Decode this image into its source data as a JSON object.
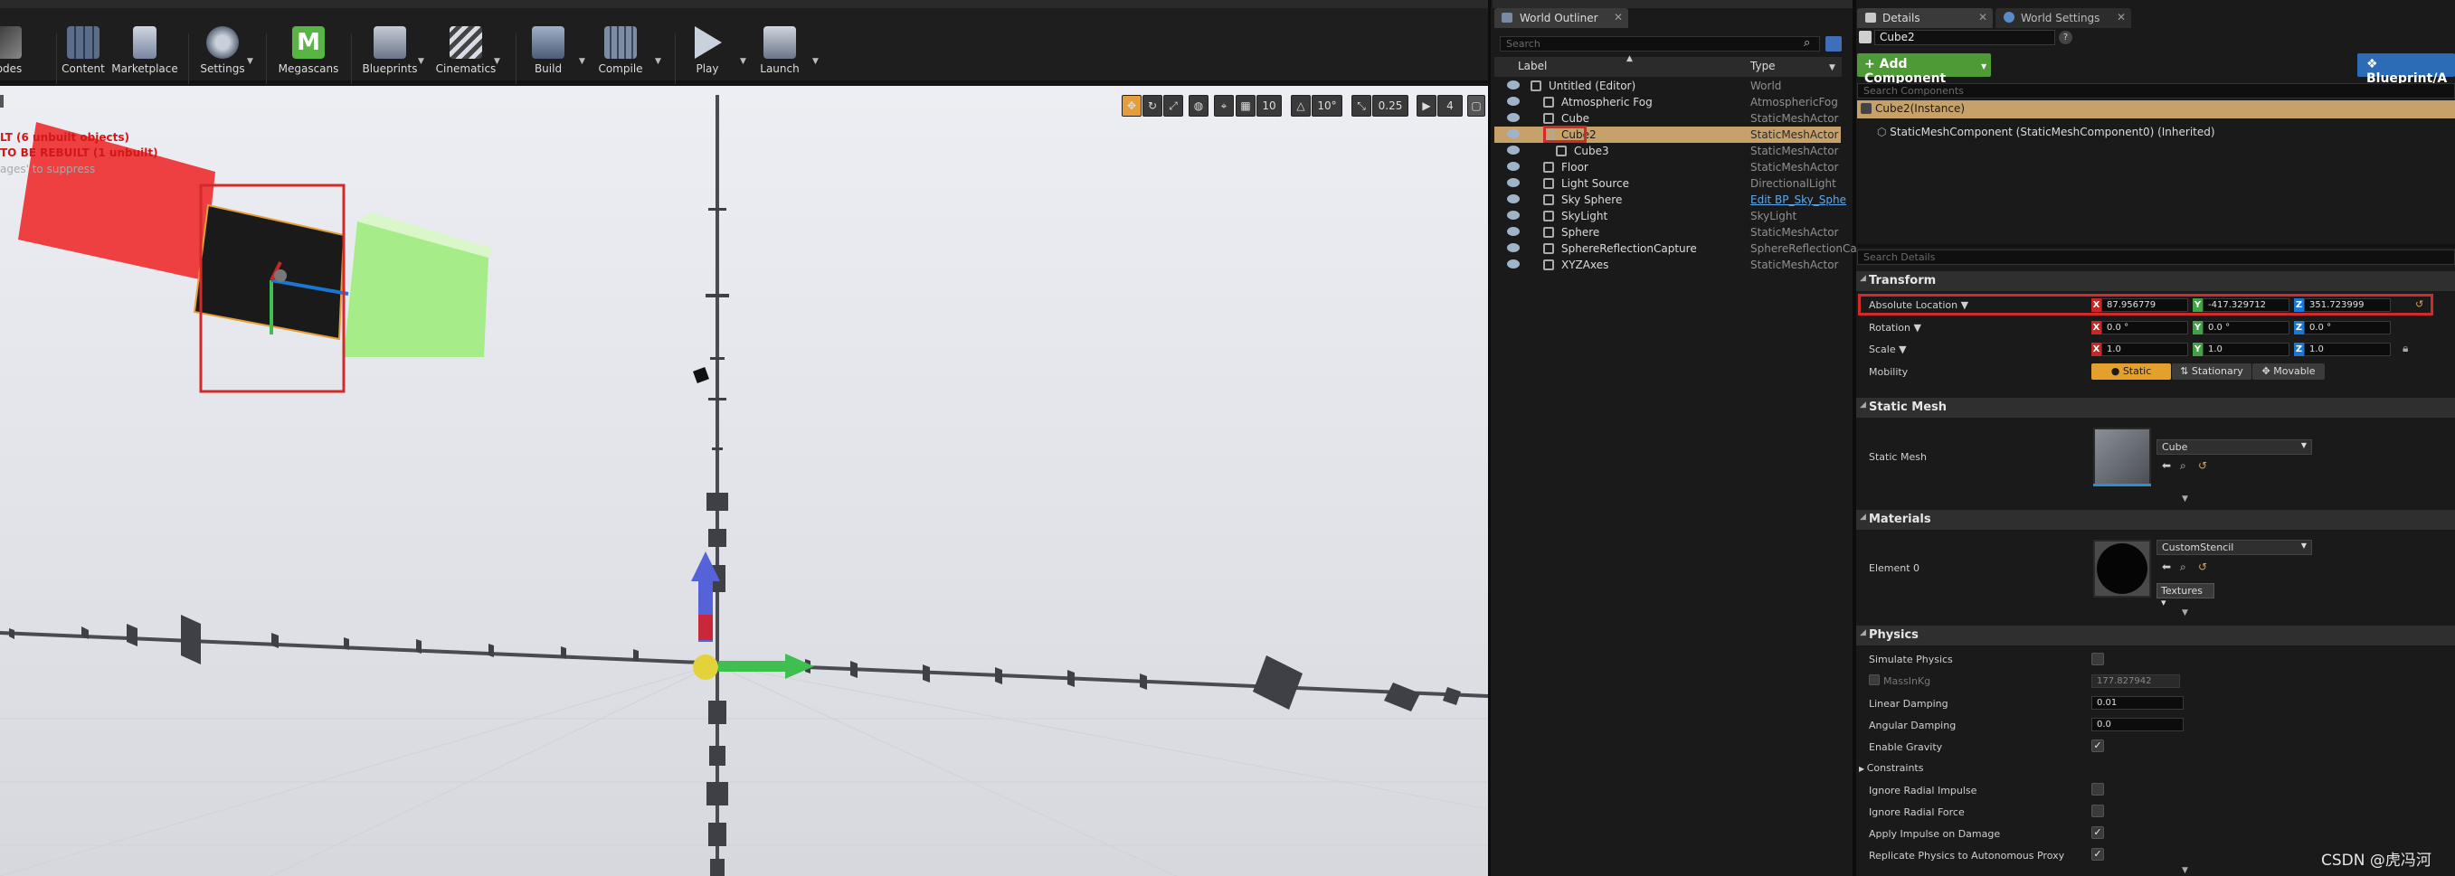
{
  "toolbar": {
    "buttons": [
      {
        "label": "odes",
        "icon": "modes-icon"
      },
      {
        "label": "Content",
        "icon": "content-icon"
      },
      {
        "label": "Marketplace",
        "icon": "marketplace-icon"
      },
      {
        "label": "Settings",
        "icon": "settings-icon"
      },
      {
        "label": "Megascans",
        "icon": "megascans-icon"
      },
      {
        "label": "Blueprints",
        "icon": "blueprints-icon"
      },
      {
        "label": "Cinematics",
        "icon": "cinematics-icon"
      },
      {
        "label": "Build",
        "icon": "build-icon"
      },
      {
        "label": "Compile",
        "icon": "compile-icon"
      },
      {
        "label": "Play",
        "icon": "play-icon"
      },
      {
        "label": "Launch",
        "icon": "launch-icon"
      }
    ]
  },
  "viewport": {
    "messages": [
      "LT (6 unbuilt objects)",
      "TO BE REBUILT (1 unbuilt)",
      "ages' to suppress"
    ],
    "snap": {
      "grid": "10",
      "rotation": "10°",
      "scale": "0.25",
      "camera_speed": "4"
    }
  },
  "outliner": {
    "tab_title": "World Outliner",
    "search_placeholder": "Search",
    "col_label": "Label",
    "col_type": "Type",
    "rows": [
      {
        "label": "Untitled (Editor)",
        "type": "World",
        "indent": 0,
        "selected": false
      },
      {
        "label": "Atmospheric Fog",
        "type": "AtmosphericFog",
        "indent": 1,
        "selected": false
      },
      {
        "label": "Cube",
        "type": "StaticMeshActor",
        "indent": 1,
        "selected": false
      },
      {
        "label": "Cube2",
        "type": "StaticMeshActor",
        "indent": 1,
        "selected": true
      },
      {
        "label": "Cube3",
        "type": "StaticMeshActor",
        "indent": 2,
        "selected": false
      },
      {
        "label": "Floor",
        "type": "StaticMeshActor",
        "indent": 1,
        "selected": false
      },
      {
        "label": "Light Source",
        "type": "DirectionalLight",
        "indent": 1,
        "selected": false
      },
      {
        "label": "Sky Sphere",
        "type": "Edit BP_Sky_Sphe",
        "indent": 1,
        "selected": false
      },
      {
        "label": "SkyLight",
        "type": "SkyLight",
        "indent": 1,
        "selected": false
      },
      {
        "label": "Sphere",
        "type": "StaticMeshActor",
        "indent": 1,
        "selected": false
      },
      {
        "label": "SphereReflectionCapture",
        "type": "SphereReflectionCa",
        "indent": 1,
        "selected": false
      },
      {
        "label": "XYZAxes",
        "type": "StaticMeshActor",
        "indent": 1,
        "selected": false
      }
    ]
  },
  "details": {
    "tab_title": "Details",
    "world_settings_tab": "World Settings",
    "actor_name": "Cube2",
    "add_component": "+ Add Component",
    "blueprint_button": "Blueprint/A",
    "search_components": "Search Components",
    "instance_row": "Cube2(Instance)",
    "component_row": "StaticMeshComponent (StaticMeshComponent0) (Inherited)",
    "search_details": "Search Details",
    "transform": {
      "title": "Transform",
      "location_label": "Absolute Location",
      "location": {
        "x": "87.956779",
        "y": "-417.329712",
        "z": "351.723999"
      },
      "rotation_label": "Rotation",
      "rotation": {
        "x": "0.0 °",
        "y": "0.0 °",
        "z": "0.0 °"
      },
      "scale_label": "Scale",
      "scale": {
        "x": "1.0",
        "y": "1.0",
        "z": "1.0"
      },
      "mobility_label": "Mobility",
      "mobility": [
        "Static",
        "Stationary",
        "Movable"
      ]
    },
    "static_mesh": {
      "title": "Static Mesh",
      "label": "Static Mesh",
      "value": "Cube"
    },
    "materials": {
      "title": "Materials",
      "element_label": "Element 0",
      "value": "CustomStencil",
      "textures": "Textures"
    },
    "physics": {
      "title": "Physics",
      "simulate": "Simulate Physics",
      "mass_label": "MassInKg",
      "mass_value": "177.827942",
      "linear_damping_label": "Linear Damping",
      "linear_damping": "0.01",
      "angular_damping_label": "Angular Damping",
      "angular_damping": "0.0",
      "gravity_label": "Enable Gravity",
      "constraints_label": "Constraints",
      "ignore_radial_impulse": "Ignore Radial Impulse",
      "ignore_radial_force": "Ignore Radial Force",
      "apply_impulse": "Apply Impulse on Damage",
      "replicate": "Replicate Physics to Autonomous Proxy"
    }
  },
  "watermark": "CSDN @虎冯河",
  "colors": {
    "accent_green": "#4e9a36",
    "selection_orange": "#e49f3a",
    "highlight_red": "#d22a2a",
    "axis_x": "#c62828",
    "axis_y": "#4caf50",
    "axis_z": "#1976d2"
  }
}
